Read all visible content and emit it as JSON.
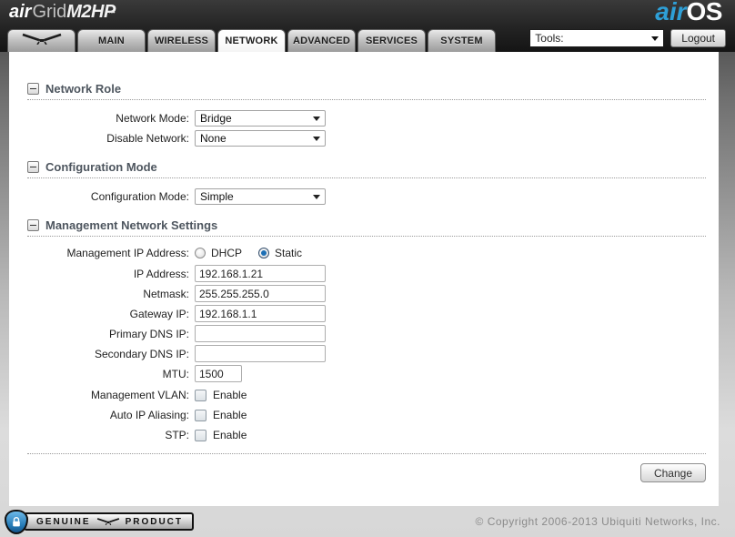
{
  "header": {
    "logo_left_air": "air",
    "logo_left_grid": "Grid",
    "logo_left_model": "M2HP",
    "logo_right_air": "air",
    "logo_right_os": "OS",
    "tools_label": "Tools:",
    "logout_label": "Logout"
  },
  "tabs": {
    "main": "MAIN",
    "wireless": "WIRELESS",
    "network": "NETWORK",
    "advanced": "ADVANCED",
    "services": "SERVICES",
    "system": "SYSTEM",
    "active": "NETWORK"
  },
  "network_role": {
    "title": "Network Role",
    "network_mode": {
      "label": "Network Mode:",
      "value": "Bridge"
    },
    "disable_network": {
      "label": "Disable Network:",
      "value": "None"
    }
  },
  "configuration_mode": {
    "title": "Configuration Mode",
    "config_mode": {
      "label": "Configuration Mode:",
      "value": "Simple"
    }
  },
  "management": {
    "title": "Management Network Settings",
    "mgmt_ip": {
      "label": "Management IP Address:",
      "dhcp_label": "DHCP",
      "static_label": "Static",
      "selected": "Static"
    },
    "ip_address": {
      "label": "IP Address:",
      "value": "192.168.1.21"
    },
    "netmask": {
      "label": "Netmask:",
      "value": "255.255.255.0"
    },
    "gateway": {
      "label": "Gateway IP:",
      "value": "192.168.1.1"
    },
    "primary_dns": {
      "label": "Primary DNS IP:",
      "value": ""
    },
    "secondary_dns": {
      "label": "Secondary DNS IP:",
      "value": ""
    },
    "mtu": {
      "label": "MTU:",
      "value": "1500"
    },
    "mgmt_vlan": {
      "label": "Management VLAN:",
      "enable_label": "Enable",
      "checked": false
    },
    "auto_ip_aliasing": {
      "label": "Auto IP Aliasing:",
      "enable_label": "Enable",
      "checked": false
    },
    "stp": {
      "label": "STP:",
      "enable_label": "Enable",
      "checked": false
    }
  },
  "actions": {
    "change_label": "Change"
  },
  "footer": {
    "badge": {
      "genuine": "GENUINE",
      "product": "PRODUCT"
    },
    "copyright": "© Copyright 2006-2013 Ubiquiti Networks, Inc."
  },
  "colors": {
    "brand_blue": "#2e9fd6",
    "radio_selected_blue": "#1d6fb5"
  }
}
